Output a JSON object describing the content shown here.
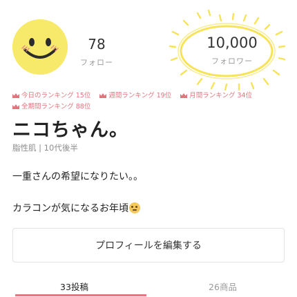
{
  "profile": {
    "username": "ニコちゃん。",
    "meta": "脂性肌 | 10代後半",
    "bio_line1": "一重さんの希望になりたい。。",
    "bio_line2": "カラコンが気になるお年頃"
  },
  "stats": {
    "follow_count": "78",
    "follow_label": "フォロー",
    "follower_count": "10,000",
    "follower_label": "フォロワー"
  },
  "rankings": {
    "row1": [
      {
        "label": "今日のランキング",
        "value": "15位"
      },
      {
        "label": "週間ランキング",
        "value": "19位"
      },
      {
        "label": "月間ランキング",
        "value": "34位"
      }
    ],
    "row2": [
      {
        "label": "全期間ランキング",
        "value": "88位"
      }
    ]
  },
  "edit_button_label": "プロフィールを編集する",
  "tabs": [
    {
      "label": "33投稿",
      "active": true
    },
    {
      "label": "26商品",
      "active": false
    }
  ],
  "colors": {
    "accent_pink": "#e0757d",
    "avatar_yellow": "#f7e96a",
    "highlight_yellow": "#f6e35a"
  },
  "icons": {
    "avatar": "smiley-face-icon",
    "ranking": "crown-icon",
    "bio_emoji": "pleading-face-emoji"
  }
}
